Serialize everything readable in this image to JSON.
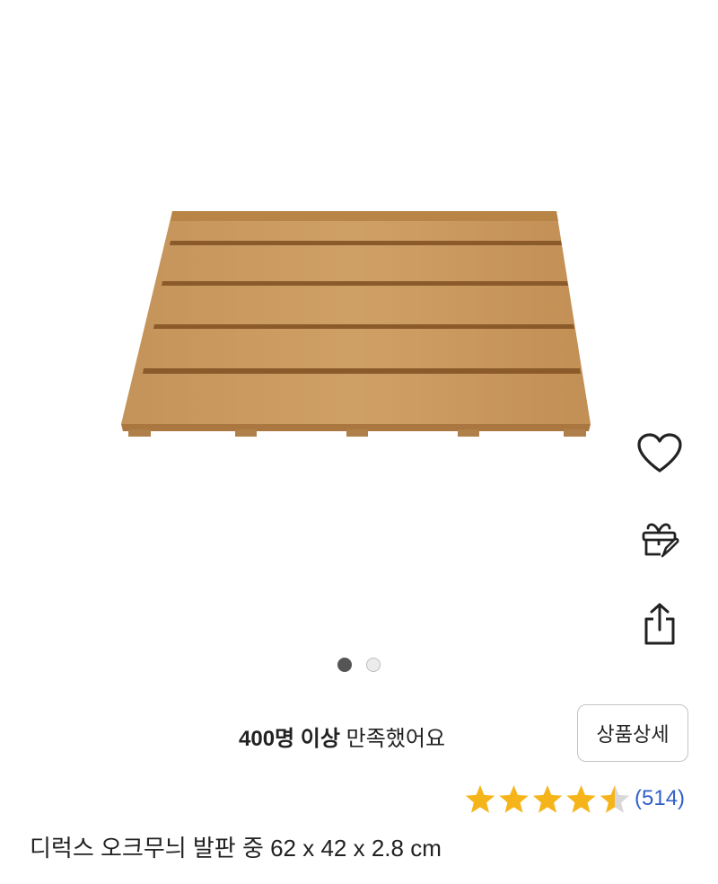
{
  "product": {
    "title": "디럭스 오크무늬 발판 중 62 x 42 x 2.8 cm",
    "image_subject": "wooden slatted bath mat"
  },
  "carousel": {
    "page_count": 2,
    "active_index": 0
  },
  "actions": {
    "wishlist_icon": "heart-icon",
    "gift_icon": "gift-icon",
    "share_icon": "share-icon"
  },
  "satisfaction": {
    "count_label": "400명 이상",
    "suffix": " 만족했어요"
  },
  "detail_button": {
    "label": "상품상세"
  },
  "rating": {
    "value": 4.5,
    "max": 5,
    "review_count": "(514)"
  },
  "colors": {
    "star_fill": "#f5b51a",
    "star_empty": "#d8d8d8",
    "review_link": "#3060c8",
    "dot_active": "#555555",
    "dot_inactive": "#ececec",
    "wood": "#c7975a"
  }
}
